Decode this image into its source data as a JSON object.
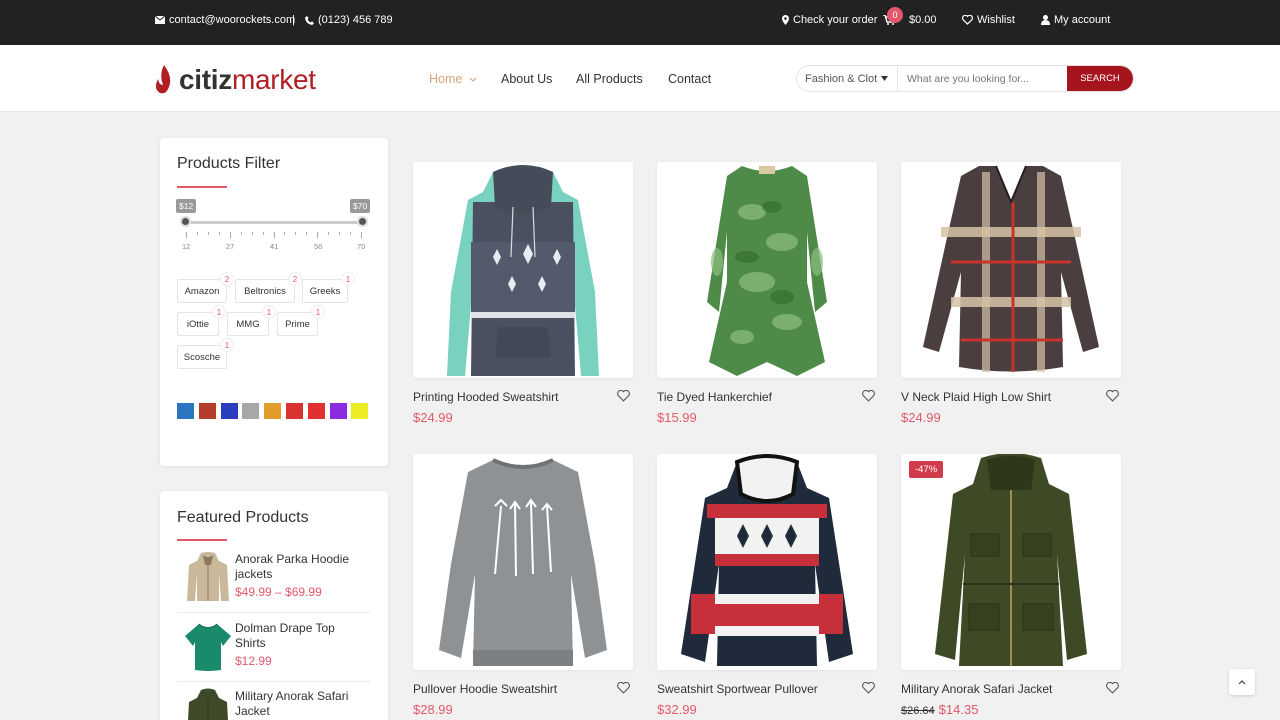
{
  "topbar": {
    "email": "contact@woorockets.com",
    "divider": "|",
    "phone": "(0123) 456 789",
    "check_order": "Check your order",
    "cart_count": "0",
    "cart_total": "$0.00",
    "wishlist": "Wishlist",
    "account": "My account"
  },
  "header": {
    "logo_bold": "citiz",
    "logo_light": "market",
    "nav": [
      "Home",
      "About Us",
      "All Products",
      "Contact"
    ],
    "search_category": "Fashion & Clothing",
    "search_placeholder": "What are you looking for...",
    "search_button": "SEARCH"
  },
  "filter": {
    "title": "Products Filter",
    "price_min_label": "$12",
    "price_max_label": "$70",
    "range_min": 12,
    "range_max": 70,
    "tick_labels": [
      "12",
      "27",
      "41",
      "56",
      "70"
    ],
    "brands": [
      {
        "name": "Amazon",
        "count": "2"
      },
      {
        "name": "Beltronics",
        "count": "2"
      },
      {
        "name": "Greeks",
        "count": "1"
      },
      {
        "name": "iOttie",
        "count": "1"
      },
      {
        "name": "MMG",
        "count": "1"
      },
      {
        "name": "Prime",
        "count": "1"
      },
      {
        "name": "Scosche",
        "count": "1"
      }
    ],
    "colors": [
      "#2a76c0",
      "#b43e2b",
      "#2a3fbf",
      "#a7a7a7",
      "#e29c2d",
      "#da3131",
      "#e03030",
      "#8a2be2",
      "#eded25"
    ]
  },
  "featured": {
    "title": "Featured Products",
    "items": [
      {
        "name": "Anorak Parka Hoodie jackets",
        "price": "$49.99 – $69.99"
      },
      {
        "name": "Dolman Drape Top Shirts",
        "price": "$12.99"
      },
      {
        "name": "Military Anorak Safari Jacket",
        "price": ""
      }
    ]
  },
  "products": [
    {
      "name": "Printing Hooded Sweatshirt",
      "price": "$24.99",
      "old_price": "",
      "badge": ""
    },
    {
      "name": "Tie Dyed Hankerchief",
      "price": "$15.99",
      "old_price": "",
      "badge": ""
    },
    {
      "name": "V Neck Plaid High Low Shirt",
      "price": "$24.99",
      "old_price": "",
      "badge": ""
    },
    {
      "name": "Pullover Hoodie Sweatshirt",
      "price": "$28.99",
      "old_price": "",
      "badge": ""
    },
    {
      "name": "Sweatshirt Sportwear Pullover",
      "price": "$32.99",
      "old_price": "",
      "badge": ""
    },
    {
      "name": "Military Anorak Safari Jacket",
      "price": "$14.35",
      "old_price": "$26.64",
      "badge": "-47%"
    }
  ],
  "colors": {
    "accent": "#e3586a",
    "brand_red": "#a6151e",
    "nav_active": "#d9a37a"
  }
}
